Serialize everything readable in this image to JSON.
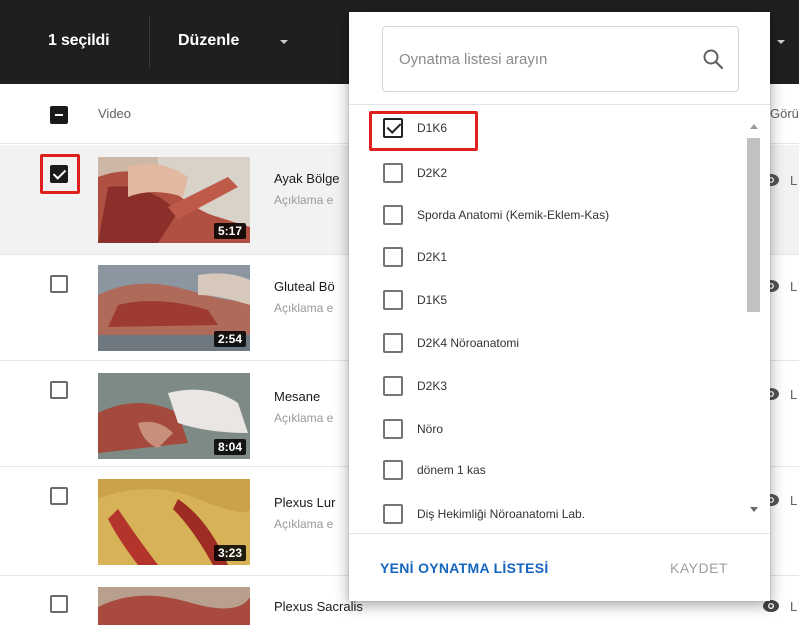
{
  "toolbar": {
    "selected_count": "1 seçildi",
    "edit_label": "Düzenle"
  },
  "table": {
    "video_header": "Video",
    "right_header": "Görün",
    "rows": [
      {
        "title": "Ayak Bölge",
        "description": "Açıklama e",
        "duration": "5:17",
        "selected": true,
        "visibility": "L"
      },
      {
        "title": "Gluteal Bö",
        "description": "Açıklama e",
        "duration": "2:54",
        "selected": false,
        "visibility": "L"
      },
      {
        "title": "Mesane",
        "description": "Açıklama e",
        "duration": "8:04",
        "selected": false,
        "visibility": "L"
      },
      {
        "title": "Plexus Lur",
        "description": "Açıklama e",
        "duration": "3:23",
        "selected": false,
        "visibility": "L"
      },
      {
        "title": "Plexus Sacralis",
        "description": "",
        "duration": "",
        "selected": false,
        "visibility": "L"
      }
    ]
  },
  "playlist_popup": {
    "search_placeholder": "Oynatma listesi arayın",
    "items": [
      {
        "label": "D1K6",
        "checked": true
      },
      {
        "label": "D2K2",
        "checked": false
      },
      {
        "label": "Sporda Anatomi (Kemik-Eklem-Kas)",
        "checked": false
      },
      {
        "label": "D2K1",
        "checked": false
      },
      {
        "label": "D1K5",
        "checked": false
      },
      {
        "label": "D2K4 Nöroanatomi",
        "checked": false
      },
      {
        "label": "D2K3",
        "checked": false
      },
      {
        "label": "Nöro",
        "checked": false
      },
      {
        "label": "dönem 1 kas",
        "checked": false
      },
      {
        "label": "Diş Hekimliği Nöroanatomi Lab.",
        "checked": false
      }
    ],
    "new_playlist_label": "YENİ OYNATMA LİSTESİ",
    "save_label": "KAYDET"
  },
  "colors": {
    "topbar": "#1f1f1f",
    "highlight": "#e0201e",
    "link_blue": "#1565c0"
  }
}
